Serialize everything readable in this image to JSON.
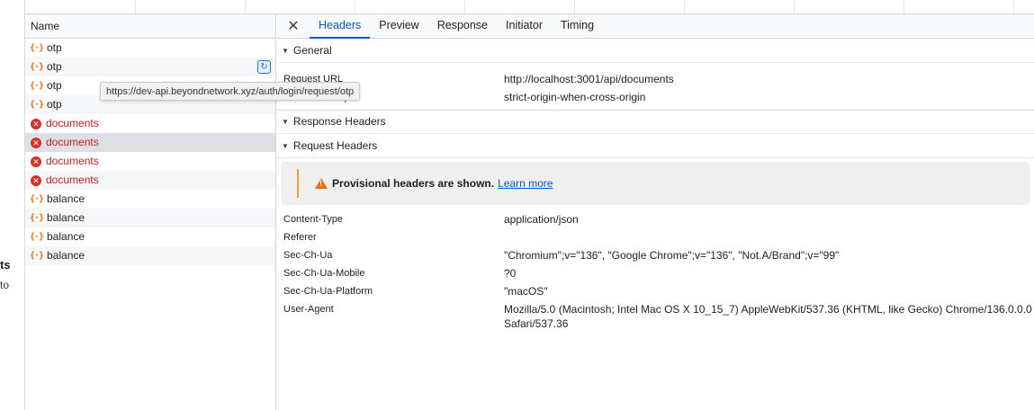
{
  "page_fragments": {
    "frag1": "ts",
    "frag2": "to"
  },
  "name_column": {
    "header": "Name",
    "tooltip": "https://dev-api.beyondnetwork.xyz/auth/login/request/otp",
    "requests": [
      {
        "name": "otp",
        "type": "fetch",
        "status": "ok"
      },
      {
        "name": "otp",
        "type": "fetch",
        "status": "ok"
      },
      {
        "name": "otp",
        "type": "fetch",
        "status": "ok"
      },
      {
        "name": "otp",
        "type": "fetch",
        "status": "ok"
      },
      {
        "name": "documents",
        "type": "error",
        "status": "error"
      },
      {
        "name": "documents",
        "type": "error",
        "status": "error"
      },
      {
        "name": "documents",
        "type": "error",
        "status": "error"
      },
      {
        "name": "documents",
        "type": "error",
        "status": "error"
      },
      {
        "name": "balance",
        "type": "fetch",
        "status": "ok"
      },
      {
        "name": "balance",
        "type": "fetch",
        "status": "ok"
      },
      {
        "name": "balance",
        "type": "fetch",
        "status": "ok"
      },
      {
        "name": "balance",
        "type": "fetch",
        "status": "ok"
      }
    ]
  },
  "details": {
    "close_glyph": "✕",
    "tabs": [
      "Headers",
      "Preview",
      "Response",
      "Initiator",
      "Timing"
    ],
    "active_tab": "Headers",
    "general": {
      "title": "General",
      "rows": [
        {
          "key": "Request URL",
          "value": "http://localhost:3001/api/documents"
        },
        {
          "key": "Referrer Policy",
          "value": "strict-origin-when-cross-origin"
        }
      ]
    },
    "response_headers_title": "Response Headers",
    "request_headers": {
      "title": "Request Headers",
      "notice": "Provisional headers are shown.",
      "notice_link": "Learn more",
      "rows": [
        {
          "key": "Content-Type",
          "value": "application/json"
        },
        {
          "key": "Referer",
          "value": ""
        },
        {
          "key": "Sec-Ch-Ua",
          "value": "\"Chromium\";v=\"136\", \"Google Chrome\";v=\"136\", \"Not.A/Brand\";v=\"99\""
        },
        {
          "key": "Sec-Ch-Ua-Mobile",
          "value": "?0"
        },
        {
          "key": "Sec-Ch-Ua-Platform",
          "value": "\"macOS\""
        },
        {
          "key": "User-Agent",
          "value": "Mozilla/5.0 (Macintosh; Intel Mac OS X 10_15_7) AppleWebKit/537.36 (KHTML, like Gecko) Chrome/136.0.0.0 Safari/537.36"
        }
      ]
    }
  },
  "colors": {
    "accent": "#0b57d0",
    "error": "#c5221f",
    "fetch_icon": "#e8710a",
    "warning_bar": "#e8a33d"
  }
}
